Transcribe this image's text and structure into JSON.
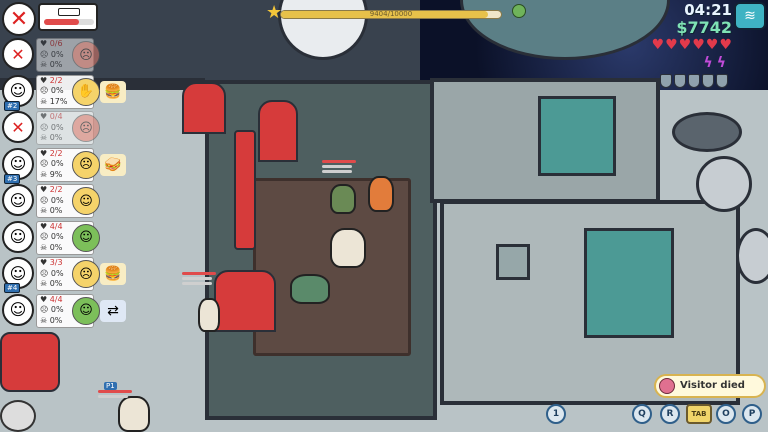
{
  "hud": {
    "clock": "04:21",
    "money": "$7742",
    "progress_text": "9404/10000",
    "progress_fraction": 0.94,
    "hearts": 6,
    "energy_bolts": 2,
    "shields": 5,
    "top_status_icon": "cross-out-icon",
    "menu_icon": "ship-logo-icon"
  },
  "crew": [
    {
      "id": "",
      "hp": "0/6",
      "stat2": "0%",
      "stat3": "0%",
      "dead": true,
      "need_icon": "angry-face",
      "item_icon": ""
    },
    {
      "id": "#2",
      "hp": "2/2",
      "stat2": "0%",
      "stat3": "17%",
      "dead": false,
      "need_icon": "wave",
      "item_icon": "burger"
    },
    {
      "id": "",
      "hp": "0/4",
      "stat2": "0%",
      "stat3": "0%",
      "dead": true,
      "need_icon": "angry-face",
      "item_icon": ""
    },
    {
      "id": "#3",
      "hp": "2/2",
      "stat2": "0%",
      "stat3": "9%",
      "dead": false,
      "need_icon": "sick-face",
      "item_icon": "sandwich"
    },
    {
      "id": "",
      "hp": "2/2",
      "stat2": "0%",
      "stat3": "0%",
      "dead": false,
      "need_icon": "happy-face",
      "item_icon": ""
    },
    {
      "id": "",
      "hp": "4/4",
      "stat2": "0%",
      "stat3": "0%",
      "dead": false,
      "need_icon": "green-face",
      "item_icon": ""
    },
    {
      "id": "#4",
      "hp": "3/3",
      "stat2": "0%",
      "stat3": "0%",
      "dead": false,
      "need_icon": "sick-face",
      "item_icon": "burger"
    },
    {
      "id": "",
      "hp": "4/4",
      "stat2": "0%",
      "stat3": "0%",
      "dead": false,
      "need_icon": "green-face",
      "item_icon": "swap"
    }
  ],
  "notification": {
    "text": "Visitor died",
    "icon": "skull-icon"
  },
  "bottom_keys": [
    "1",
    "Q",
    "R",
    "TAB",
    "O",
    "P"
  ],
  "player_label": "P1",
  "colors": {
    "hearts": "#e23a4b",
    "energy": "#c14bd8",
    "money": "#7fe2b5",
    "progress": "#e7c14a",
    "danger": "#d22222"
  }
}
